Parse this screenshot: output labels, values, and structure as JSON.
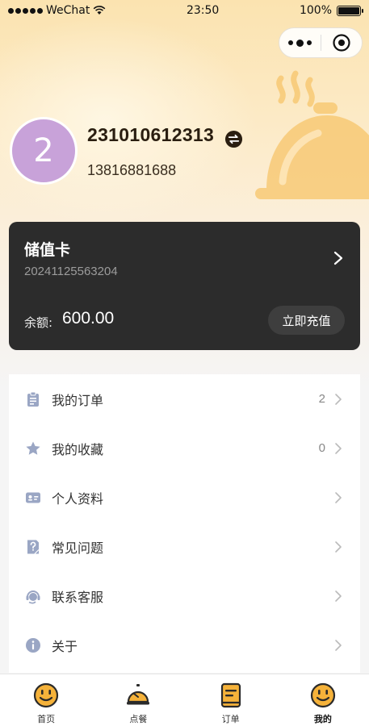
{
  "status_bar": {
    "carrier": "WeChat",
    "time": "23:50",
    "battery": "100%"
  },
  "profile": {
    "avatar_text": "2",
    "user_id": "231010612313",
    "phone": "13816881688"
  },
  "stored_card": {
    "title": "储值卡",
    "card_number": "20241125563204",
    "balance_label": "余额:",
    "balance_value": "600.00",
    "recharge_label": "立即充值"
  },
  "menu": {
    "items": [
      {
        "label": "我的订单",
        "count": "2",
        "icon": "clipboard-icon"
      },
      {
        "label": "我的收藏",
        "count": "0",
        "icon": "star-icon"
      },
      {
        "label": "个人资料",
        "count": "",
        "icon": "id-card-icon"
      },
      {
        "label": "常见问题",
        "count": "",
        "icon": "faq-icon"
      },
      {
        "label": "联系客服",
        "count": "",
        "icon": "headset-icon"
      },
      {
        "label": "关于",
        "count": "",
        "icon": "info-icon"
      }
    ]
  },
  "tabbar": {
    "items": [
      {
        "label": "首页",
        "icon": "smiley-home-icon",
        "active": false
      },
      {
        "label": "点餐",
        "icon": "service-bell-icon",
        "active": false
      },
      {
        "label": "订单",
        "icon": "order-note-icon",
        "active": false
      },
      {
        "label": "我的",
        "icon": "smiley-profile-icon",
        "active": true
      }
    ]
  },
  "colors": {
    "accent": "#f5b23a",
    "card_bg": "#2c2c2c",
    "avatar_bg": "#c8a2d9",
    "menu_icon": "#9aa6c4"
  }
}
